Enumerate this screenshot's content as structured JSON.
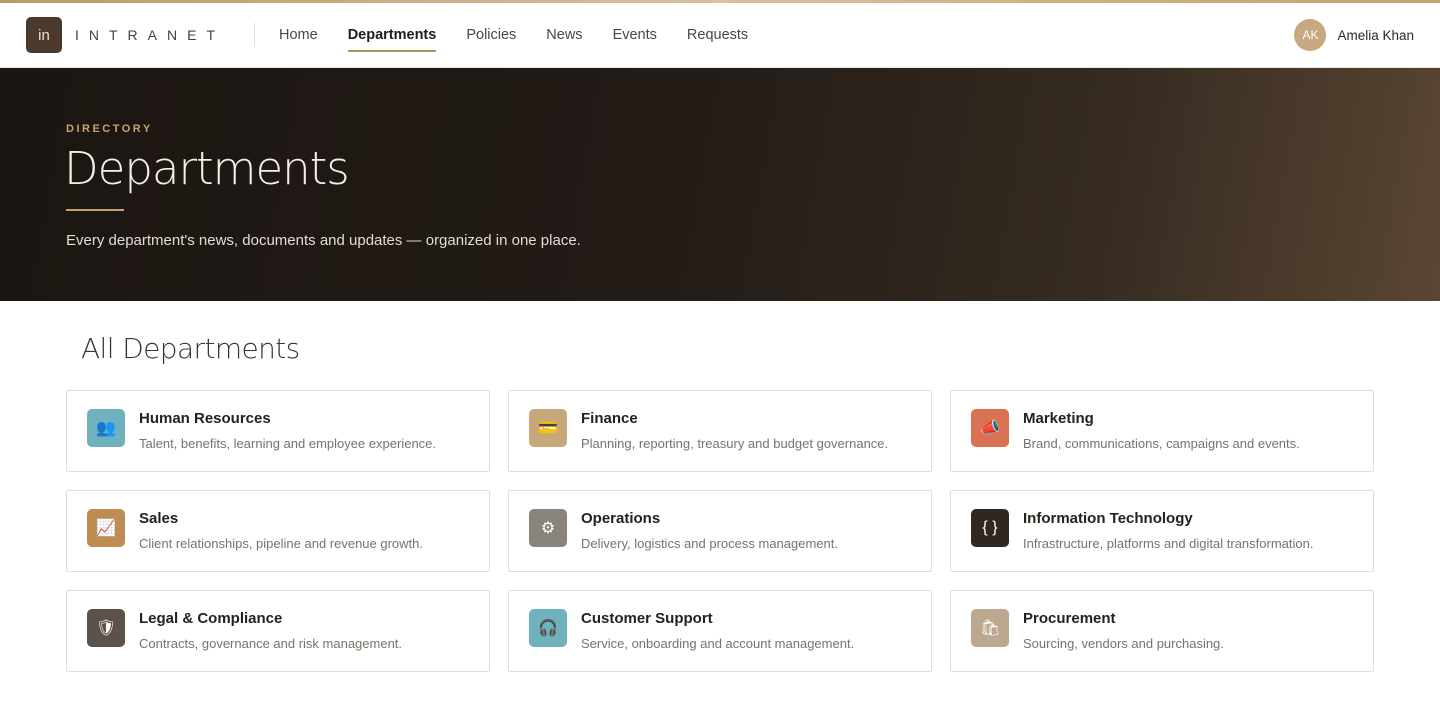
{
  "brand": {
    "logo_mark": "in",
    "name": "INTRANET"
  },
  "nav": {
    "items": [
      {
        "label": "Home",
        "active": false
      },
      {
        "label": "Departments",
        "active": true
      },
      {
        "label": "Policies",
        "active": false
      },
      {
        "label": "News",
        "active": false
      },
      {
        "label": "Events",
        "active": false
      },
      {
        "label": "Requests",
        "active": false
      }
    ]
  },
  "user": {
    "initials": "AK",
    "name": "Amelia Khan"
  },
  "hero": {
    "kicker": "DIRECTORY",
    "title": "Departments",
    "subtitle": "Every department's news, documents and updates — organized in one place."
  },
  "section": {
    "title": "All Departments"
  },
  "departments": [
    {
      "name": "Human Resources",
      "desc": "Talent, benefits, learning and employee experience.",
      "icon": "people-icon",
      "glyph": "👥",
      "color": "#6fb1bd"
    },
    {
      "name": "Finance",
      "desc": "Planning, reporting, treasury and budget governance.",
      "icon": "credit-card-icon",
      "glyph": "💳",
      "color": "#c8a87a"
    },
    {
      "name": "Marketing",
      "desc": "Brand, communications, campaigns and events.",
      "icon": "megaphone-icon",
      "glyph": "📣",
      "color": "#d97253"
    },
    {
      "name": "Sales",
      "desc": "Client relationships, pipeline and revenue growth.",
      "icon": "chart-up-icon",
      "glyph": "📈",
      "color": "#bf8d52"
    },
    {
      "name": "Operations",
      "desc": "Delivery, logistics and process management.",
      "icon": "gear-icon",
      "glyph": "⚙",
      "color": "#8a847e"
    },
    {
      "name": "Information Technology",
      "desc": "Infrastructure, platforms and digital transformation.",
      "icon": "code-braces-icon",
      "glyph": "{ }",
      "color": "#2f2822"
    },
    {
      "name": "Legal & Compliance",
      "desc": "Contracts, governance and risk management.",
      "icon": "shield-icon",
      "glyph": "🛡",
      "color": "#5a524b"
    },
    {
      "name": "Customer Support",
      "desc": "Service, onboarding and account management.",
      "icon": "headset-icon",
      "glyph": "🎧",
      "color": "#6fb1bd"
    },
    {
      "name": "Procurement",
      "desc": "Sourcing, vendors and purchasing.",
      "icon": "shopping-bags-icon",
      "glyph": "🛍",
      "color": "#bba88e"
    }
  ]
}
